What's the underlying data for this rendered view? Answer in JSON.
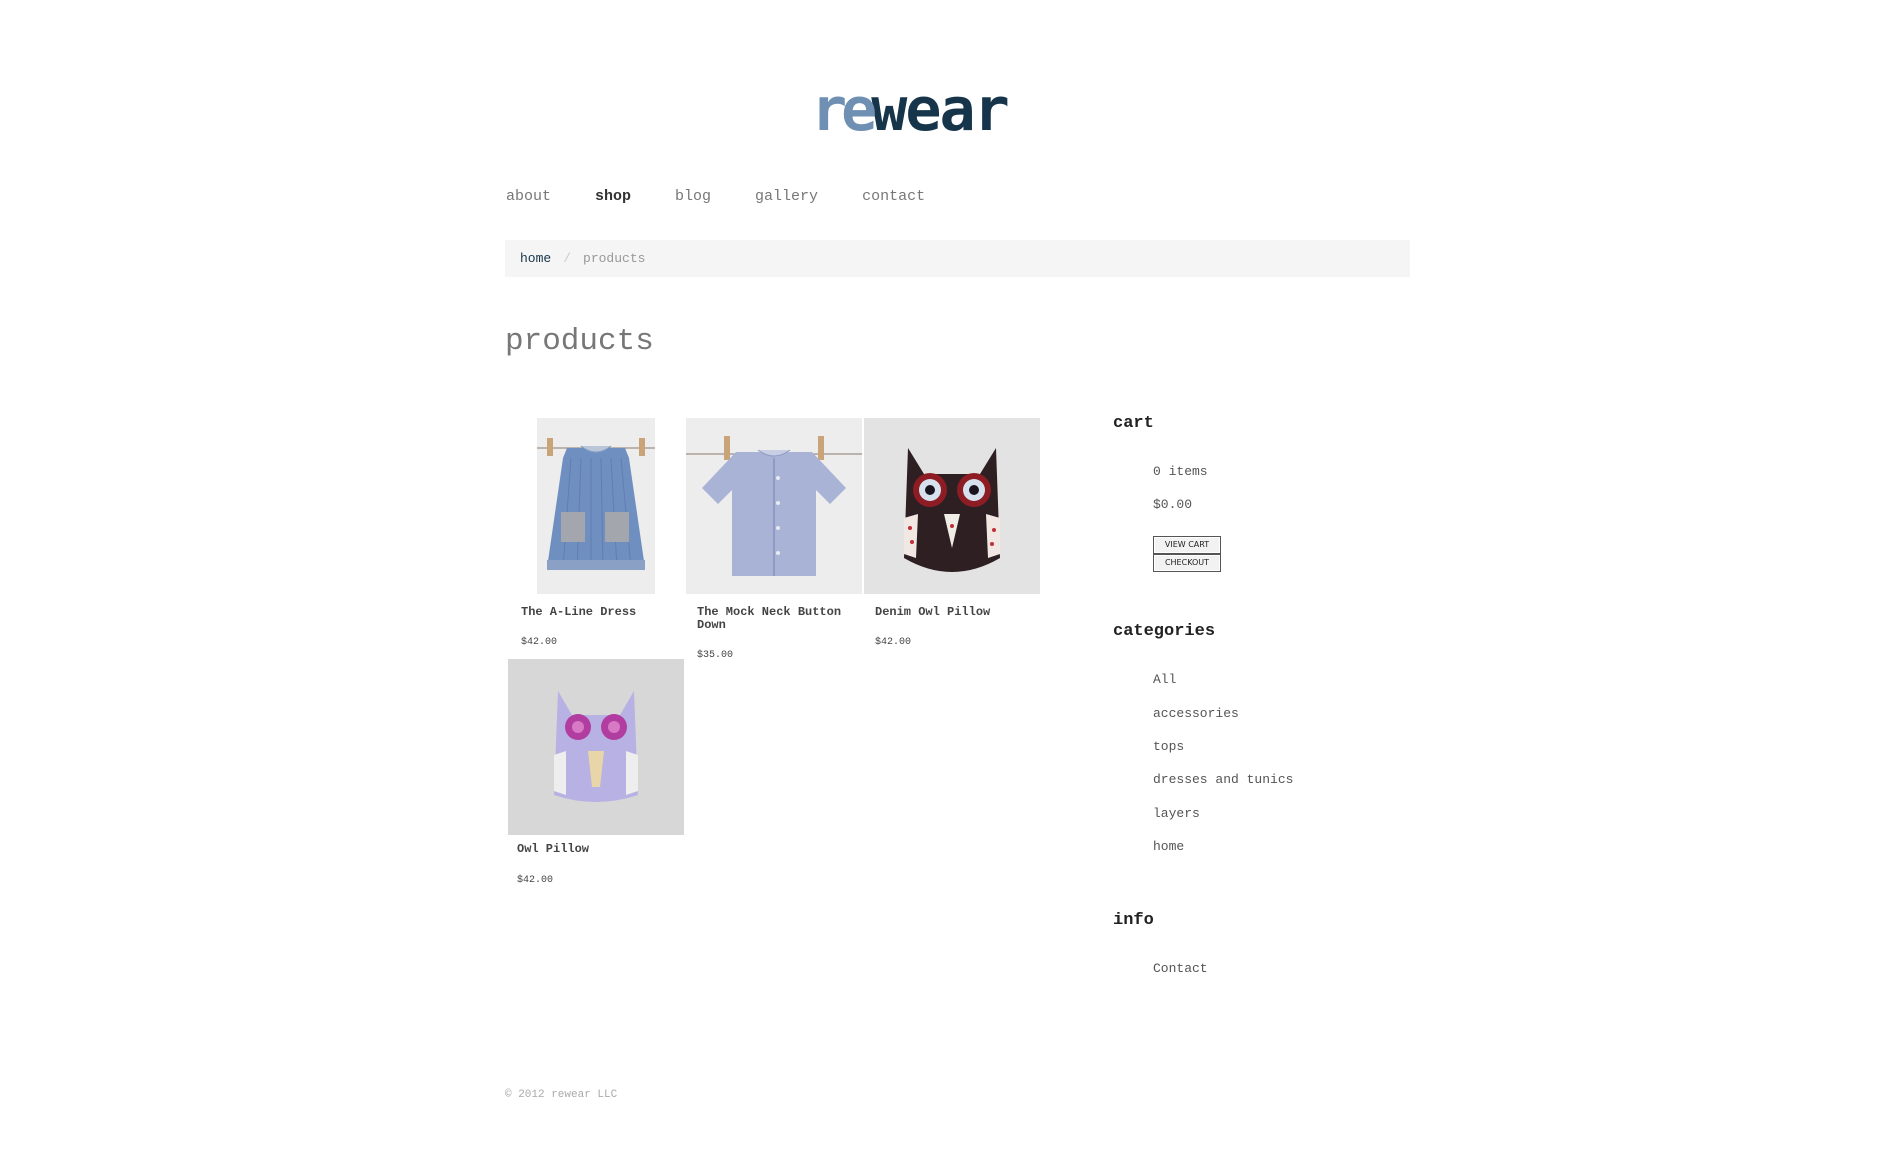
{
  "site": {
    "logo_prefix": "re",
    "logo_suffix": "wear",
    "logo_prefix_color": "#6f8fb3",
    "logo_suffix_color": "#16344a"
  },
  "nav": {
    "items": [
      {
        "label": "about",
        "active": false
      },
      {
        "label": "shop",
        "active": true
      },
      {
        "label": "blog",
        "active": false
      },
      {
        "label": "gallery",
        "active": false
      },
      {
        "label": "contact",
        "active": false
      }
    ]
  },
  "breadcrumb": {
    "home": "home",
    "separator": "/",
    "current": "products"
  },
  "page_title": "products",
  "products": [
    {
      "name": "The A-Line Dress",
      "price": "$42.00",
      "image": "denim-dress-photo"
    },
    {
      "name": "The Mock Neck Button Down",
      "price": "$35.00",
      "image": "button-down-shirt-photo"
    },
    {
      "name": "Denim Owl Pillow",
      "price": "$42.00",
      "image": "dark-owl-pillow-photo"
    },
    {
      "name": "Owl Pillow",
      "price": "$42.00",
      "image": "purple-owl-pillow-photo"
    }
  ],
  "sidebar": {
    "cart": {
      "heading": "cart",
      "items": "0 items",
      "total": "$0.00",
      "view_cart_label": "View Cart",
      "checkout_label": "Checkout"
    },
    "categories": {
      "heading": "categories",
      "items": [
        "All",
        "accessories",
        "tops",
        "dresses and tunics",
        "layers",
        "home"
      ]
    },
    "info": {
      "heading": "info",
      "items": [
        "Contact"
      ]
    }
  },
  "footer": {
    "copyright": "© 2012 rewear LLC"
  }
}
